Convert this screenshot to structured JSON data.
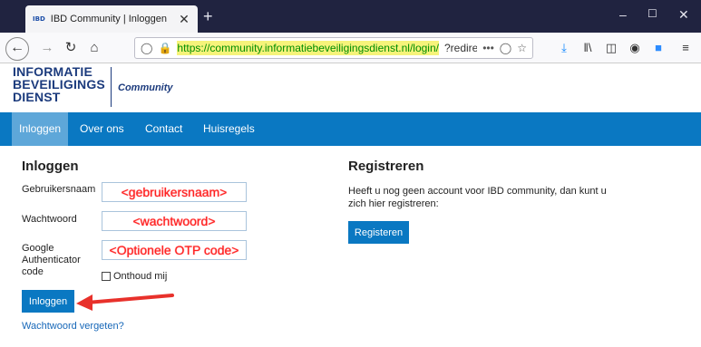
{
  "browser": {
    "tab_favicon": "IBD",
    "tab_title": "IBD Community | Inloggen",
    "tab_close": "✕",
    "new_tab": "+",
    "url_domain": "https://community.informatiebeveiligingsdienst.nl/login/",
    "url_rest": "?redirect_to=",
    "more": "•••",
    "icons": [
      "back-icon",
      "forward-icon",
      "reload-icon",
      "home-icon",
      "shield-icon",
      "lock-icon",
      "pocket-icon",
      "bookmark-star-icon",
      "download-icon",
      "library-icon",
      "sidebar-icon",
      "account-icon",
      "zoom-icon",
      "menu-icon"
    ],
    "window_controls": {
      "minimize": "–",
      "maximize": "☐",
      "close": "✕"
    }
  },
  "site": {
    "logo_line1": "INFORMATIE",
    "logo_line2": "BEVEILIGINGS",
    "logo_line3": "DIENST",
    "logo_sub": "Community",
    "brand_color": "#1c3b7d",
    "nav_color": "#0a78c2",
    "nav": [
      {
        "label": "Inloggen",
        "active": true
      },
      {
        "label": "Over ons",
        "active": false
      },
      {
        "label": "Contact",
        "active": false
      },
      {
        "label": "Huisregels",
        "active": false
      }
    ]
  },
  "login": {
    "title": "Inloggen",
    "username_label": "Gebruikersnaam",
    "username_value": "<gebruikersnaam>",
    "password_label": "Wachtwoord",
    "password_value": "<wachtwoord>",
    "otp_label_1": "Google",
    "otp_label_2": "Authenticator",
    "otp_label_3": "code",
    "otp_value": "<Optionele OTP code>",
    "remember_label": "Onthoud mij",
    "remember_checked": false,
    "submit_label": "Inloggen",
    "forgot_link": "Wachtwoord vergeten?",
    "annotation_color": "#e8312b"
  },
  "register": {
    "title": "Registreren",
    "text": "Heeft u nog geen account voor IBD community, dan kunt u zich hier registreren:",
    "button_label": "Registeren"
  }
}
